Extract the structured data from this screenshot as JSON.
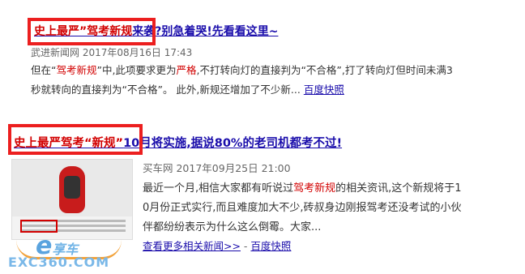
{
  "result1": {
    "title_hl": "史上最严”驾考新规",
    "title_rest": "来袭?别急着哭!先看看这里~",
    "meta": "武进新闻网  2017年08月16日 17:43",
    "line1_a": "但在“",
    "line1_hl1": "驾考新规",
    "line1_b": "”中,此项要求更为",
    "line1_hl2": "严格",
    "line1_c": ",不打转向灯的直接判为“不合格”,打了转向灯但时间未满3",
    "line2_a": "秒就转向的直接判为“不合格”。 此外,新规还增加了不少新...",
    "line2_snap": "百度快照"
  },
  "result2": {
    "title_hl": "史上最严驾考“新规”",
    "title_rest": "10月将实施,据说80%的老司机都考不过!",
    "meta": "买车网  2017年09月25日 21:00",
    "line1_a": "最近一个月,相信大家都有听说过",
    "line1_hl": "驾考新规",
    "line1_b": "的相关资讯,这个新规将于1",
    "line2": "0月份正式实行,而且难度加大不少,砖叔身边刚报驾考还没考试的小伙",
    "line3": "伴都纷纷表示为什么这么倒霉。大家...",
    "more_news": "查看更多相关新闻>>",
    "sep": " - ",
    "snap": "百度快照"
  },
  "watermark": {
    "logo_e": "e",
    "logo_text": "享车",
    "site": "EXC360.COM"
  }
}
